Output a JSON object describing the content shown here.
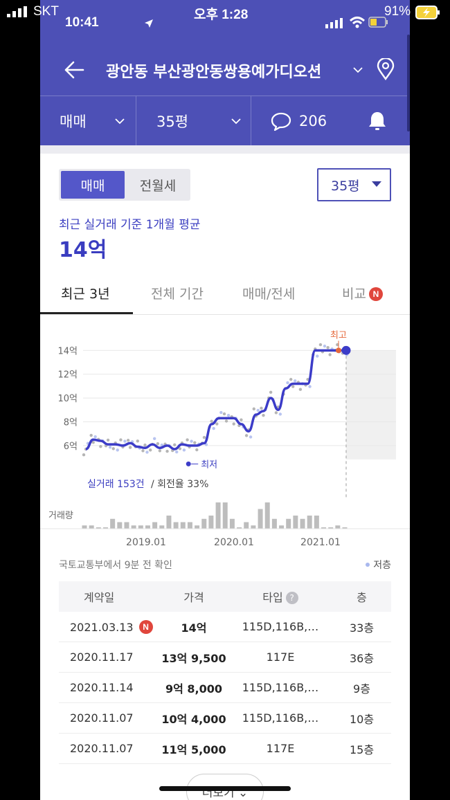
{
  "outer_status": {
    "carrier": "SKT",
    "time": "오후 1:28",
    "battery": "91%"
  },
  "inner_status": {
    "time": "10:41"
  },
  "header": {
    "title": "광안동 부산광안동쌍용예가디오션"
  },
  "filters": {
    "trade": "매매",
    "size": "35평",
    "comments": "206"
  },
  "segment": {
    "active": "매매",
    "inactive": "전월세"
  },
  "size_select": "35평",
  "avg": {
    "label": "최근 실거래 기준 1개월 평균",
    "value": "14억"
  },
  "tabs": [
    {
      "label": "최근 3년"
    },
    {
      "label": "전체 기간"
    },
    {
      "label": "매매/전세"
    },
    {
      "label": "비교"
    }
  ],
  "badge_new": "N",
  "chart_data": {
    "type": "line",
    "y_ticks": [
      "14억",
      "12억",
      "10억",
      "8억",
      "6억"
    ],
    "ylim": [
      5,
      14.6
    ],
    "x_ticks": [
      "2019.01",
      "2020.01",
      "2021.01"
    ],
    "series": [
      {
        "name": "",
        "x": [
          "2018.04",
          "2018.05",
          "2018.06",
          "2018.07",
          "2018.08",
          "2018.09",
          "2018.10",
          "2018.11",
          "2018.12",
          "2019.01",
          "2019.02",
          "2019.03",
          "2019.04",
          "2019.05",
          "2019.06",
          "2019.07",
          "2019.08",
          "2019.09",
          "2019.10",
          "2019.11",
          "2019.12",
          "2020.01",
          "2020.02",
          "2020.03",
          "2020.04",
          "2020.05",
          "2020.06",
          "2020.07",
          "2020.08",
          "2020.09",
          "2020.10",
          "2020.11",
          "2020.12",
          "2021.01",
          "2021.02",
          "2021.03"
        ],
        "values": [
          5.7,
          6.5,
          6.4,
          6.1,
          6.1,
          6.0,
          6.2,
          5.9,
          5.8,
          6.1,
          5.8,
          6.0,
          5.7,
          6.1,
          6.0,
          6.0,
          6.2,
          7.8,
          8.3,
          8.3,
          8.3,
          7.8,
          7.2,
          8.6,
          8.9,
          10.0,
          9.0,
          10.8,
          11.2,
          11.2,
          11.2,
          14.0,
          14.0,
          14.0,
          14.0,
          14.0
        ]
      }
    ],
    "annotations": {
      "high": "최고",
      "low": "최저"
    },
    "deal_summary": {
      "count": "실거래 153건",
      "turnover": "/ 회전율 33%"
    },
    "volume_label": "거래량",
    "volume": [
      1,
      1,
      0,
      0,
      3,
      2,
      2,
      1,
      1,
      1,
      2,
      1,
      4,
      2,
      2,
      2,
      1,
      3,
      4,
      8,
      8,
      3,
      0,
      2,
      1,
      6,
      8,
      3,
      1,
      3,
      4,
      3,
      4,
      4,
      0,
      0,
      1,
      0
    ],
    "legend": "저층"
  },
  "source": "국토교통부에서 9분 전 확인",
  "table": {
    "headers": [
      "계약일",
      "가격",
      "타입",
      "층"
    ],
    "rows": [
      {
        "date": "2021.03.13",
        "price": "14억",
        "type": "115D,116B,…",
        "floor": "33층",
        "new": true
      },
      {
        "date": "2020.11.17",
        "price": "13억 9,500",
        "type": "117E",
        "floor": "36층"
      },
      {
        "date": "2020.11.14",
        "price": "9억 8,000",
        "type": "115D,116B,…",
        "floor": "9층"
      },
      {
        "date": "2020.11.07",
        "price": "10억 4,000",
        "type": "115D,116B,…",
        "floor": "10층"
      },
      {
        "date": "2020.11.07",
        "price": "11억 5,000",
        "type": "117E",
        "floor": "15층"
      }
    ]
  },
  "more_button": "더보기 ⌄",
  "colors": {
    "header": "#4d50b6",
    "line": "#3c3cc8",
    "accent": "#3a3dc0",
    "high": "#e5683b",
    "badge": "#e0463c"
  }
}
